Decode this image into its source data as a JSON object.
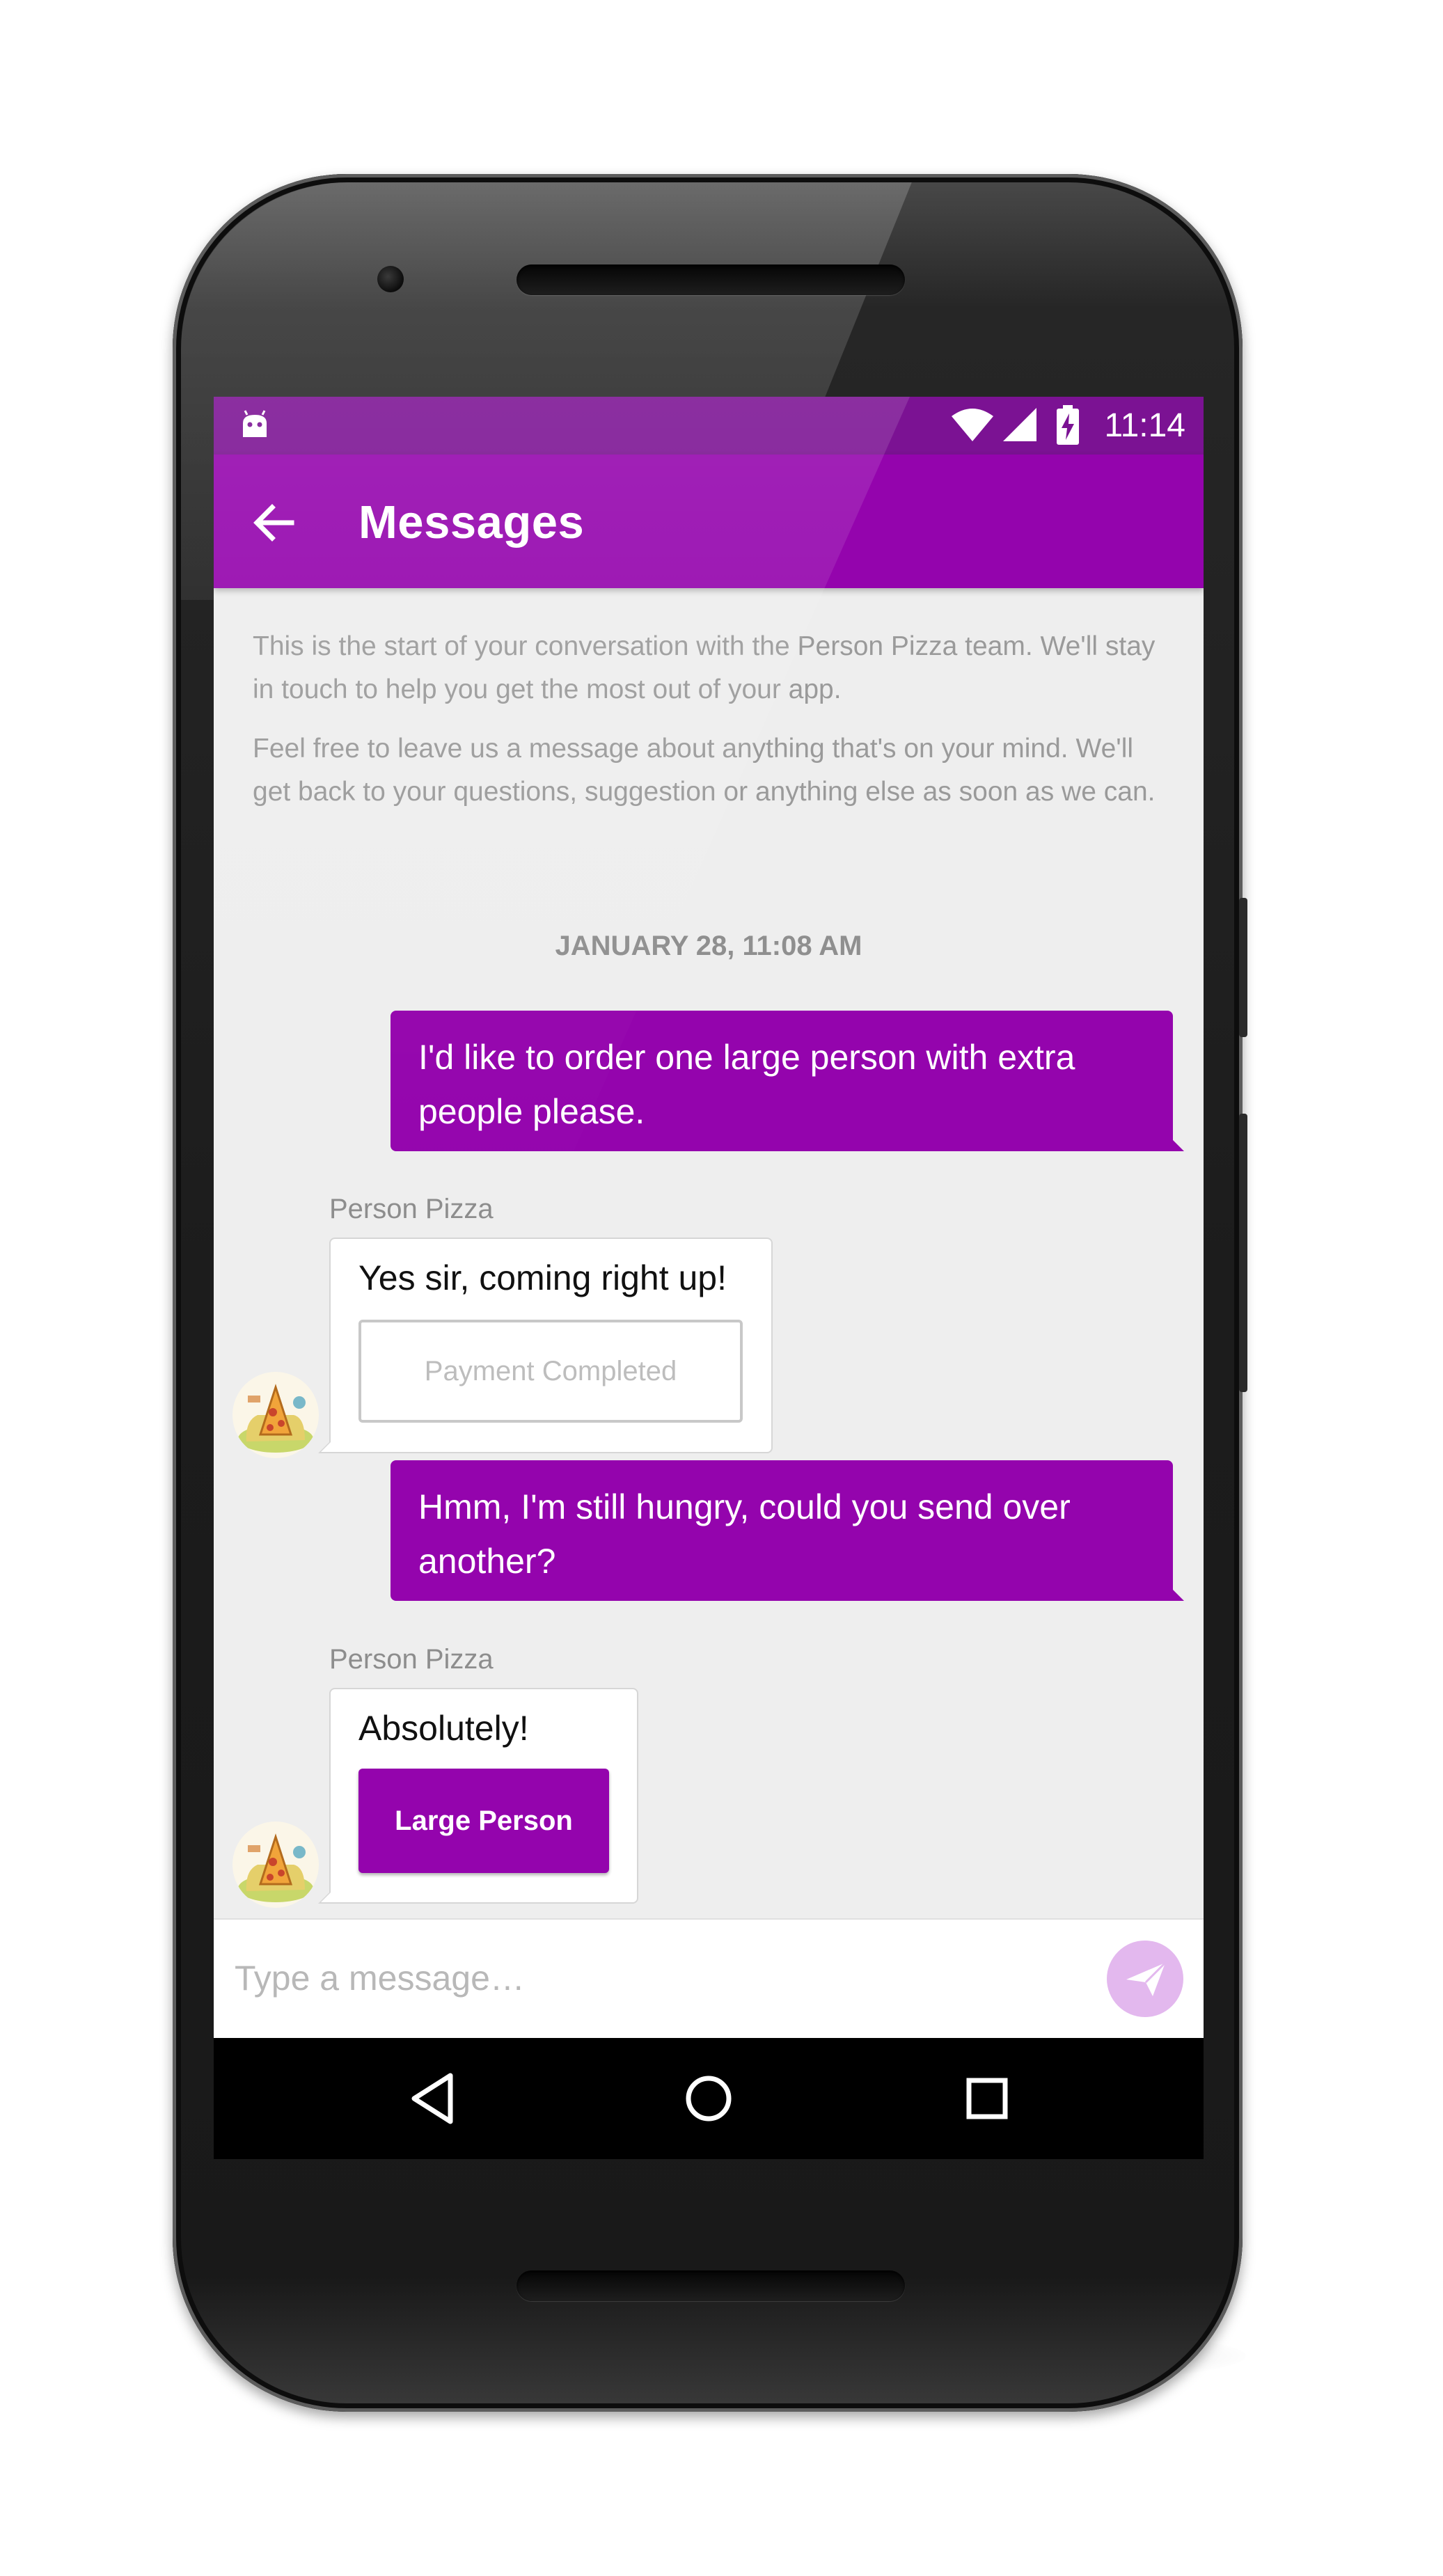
{
  "status_bar": {
    "time": "11:14"
  },
  "app_bar": {
    "title": "Messages"
  },
  "conversation": {
    "intro_paragraphs": [
      "This is the start of your conversation with the Person Pizza team. We'll stay in touch to help you get the most out of your app.",
      "Feel free to leave us a message about anything that's on your mind. We'll get back to your questions, suggestion or anything else as soon as we can."
    ],
    "date_separator": "JANUARY 28, 11:08 AM",
    "messages": [
      {
        "from": "user",
        "text": "I'd like to order one large person with extra people please."
      },
      {
        "from": "agent",
        "sender": "Person Pizza",
        "text": "Yes sir, coming right up!",
        "button": "Payment Completed"
      },
      {
        "from": "user",
        "text": "Hmm, I'm still hungry, could you send over another?"
      },
      {
        "from": "agent",
        "sender": "Person Pizza",
        "text": "Absolutely!",
        "button": "Large Person"
      }
    ]
  },
  "composer": {
    "placeholder": "Type a message…"
  },
  "colors": {
    "primary": "#9404ad",
    "primary_dark": "#7b1293",
    "send_button_disabled": "#e3b8ee",
    "chat_background": "#eeeeee"
  },
  "icons": [
    "android-notification-icon",
    "wifi-icon",
    "signal-icon",
    "battery-charging-icon",
    "back-arrow-icon",
    "send-icon",
    "nav-back-icon",
    "nav-home-icon",
    "nav-recents-icon"
  ]
}
